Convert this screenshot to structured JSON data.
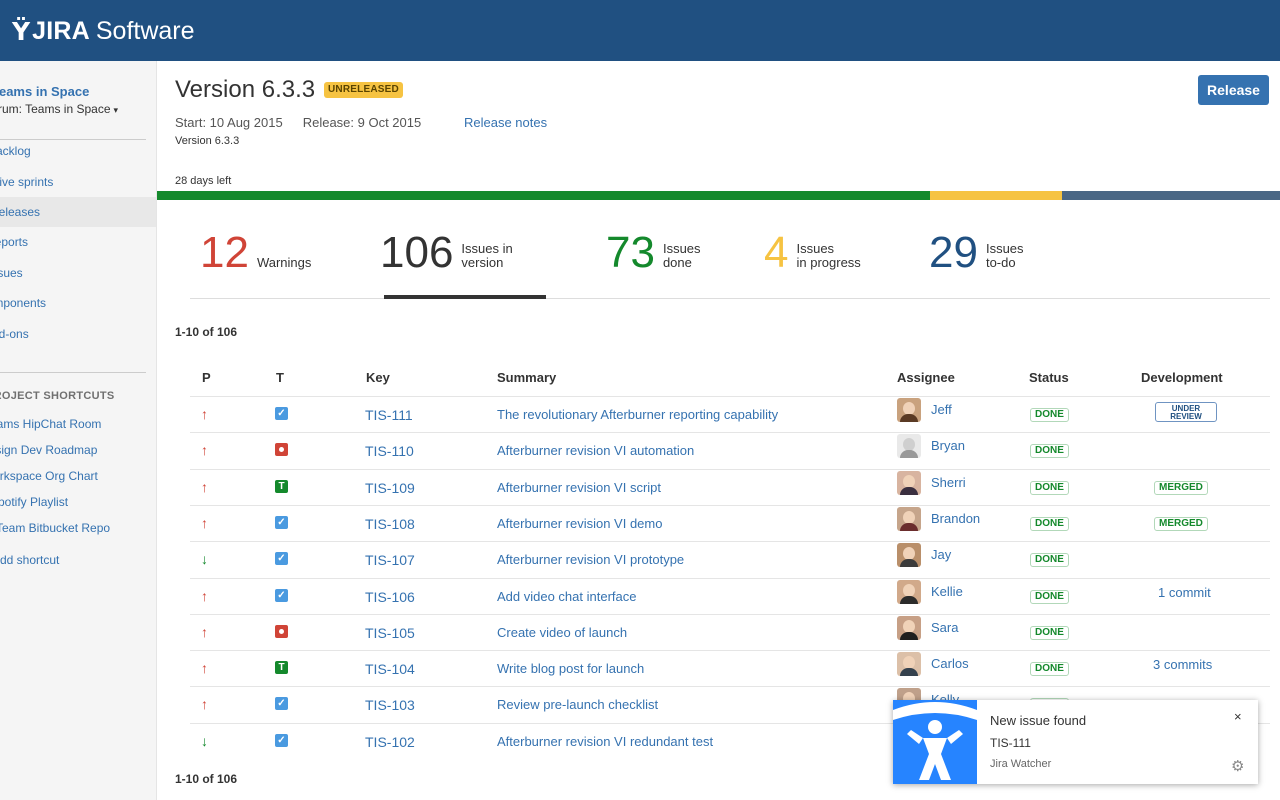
{
  "app": {
    "logo_mark": "Ÿ",
    "brand": "JIRA",
    "product": "Software"
  },
  "sidebar": {
    "project_name": "Teams in Space",
    "board_name": "Scrum: Teams in Space",
    "nav": [
      {
        "label": "Backlog",
        "active": false
      },
      {
        "label": "Active sprints",
        "active": false
      },
      {
        "label": "Releases",
        "active": true
      },
      {
        "label": "Reports",
        "active": false
      },
      {
        "label": "Issues",
        "active": false
      },
      {
        "label": "Components",
        "active": false
      },
      {
        "label": "Add-ons",
        "active": false
      }
    ],
    "shortcuts_heading": "PROJECT SHORTCUTS",
    "shortcuts": [
      "Teams HipChat Room",
      "Design Dev Roadmap",
      "Workspace Org Chart",
      "Spotify Playlist",
      "Team Bitbucket Repo",
      "Add shortcut"
    ]
  },
  "header": {
    "title": "Version 6.3.3",
    "lozenge": "UNRELEASED",
    "release_button": "Release",
    "start": "Start: 10 Aug 2015",
    "release": "Release: 9 Oct 2015",
    "release_notes": "Release notes",
    "description": "Version 6.3.3",
    "days_left": "28 days left"
  },
  "progress": {
    "done_fraction": 0.6887,
    "in_progress_fraction": 0.1174,
    "todo_fraction": 0.1939
  },
  "stats": [
    {
      "value": "12",
      "line1": "Warnings",
      "line2": "",
      "color": "#d04437"
    },
    {
      "value": "106",
      "line1": "Issues in",
      "line2": "version",
      "color": "#333333"
    },
    {
      "value": "73",
      "line1": "Issues",
      "line2": "done",
      "color": "#14892c"
    },
    {
      "value": "4",
      "line1": "Issues",
      "line2": "in progress",
      "color": "#f6c342"
    },
    {
      "value": "29",
      "line1": "Issues",
      "line2": "to-do",
      "color": "#205081"
    }
  ],
  "table": {
    "count": "1-10 of 106",
    "headers": {
      "p": "P",
      "t": "T",
      "key": "Key",
      "summary": "Summary",
      "assignee": "Assignee",
      "status": "Status",
      "development": "Development"
    },
    "rows": [
      {
        "priority": "↑",
        "priority_dir": "up",
        "type": "story",
        "key": "TIS-111",
        "summary": "The revolutionary Afterburner reporting capability",
        "assignee": "Jeff",
        "status": "DONE",
        "dev_kind": "review",
        "dev": "UNDER REVIEW"
      },
      {
        "priority": "↑",
        "priority_dir": "up",
        "type": "bug",
        "key": "TIS-110",
        "summary": "Afterburner revision VI automation",
        "assignee": "Bryan",
        "status": "DONE",
        "dev_kind": "",
        "dev": ""
      },
      {
        "priority": "↑",
        "priority_dir": "up",
        "type": "task",
        "key": "TIS-109",
        "summary": "Afterburner revision VI script",
        "assignee": "Sherri",
        "status": "DONE",
        "dev_kind": "merged",
        "dev": "MERGED"
      },
      {
        "priority": "↑",
        "priority_dir": "up",
        "type": "story",
        "key": "TIS-108",
        "summary": "Afterburner revision VI demo",
        "assignee": "Brandon",
        "status": "DONE",
        "dev_kind": "merged",
        "dev": "MERGED"
      },
      {
        "priority": "↓",
        "priority_dir": "down",
        "type": "story",
        "key": "TIS-107",
        "summary": "Afterburner revision VI prototype",
        "assignee": "Jay",
        "status": "DONE",
        "dev_kind": "",
        "dev": ""
      },
      {
        "priority": "↑",
        "priority_dir": "up",
        "type": "story",
        "key": "TIS-106",
        "summary": "Add video chat interface",
        "assignee": "Kellie",
        "status": "DONE",
        "dev_kind": "commit",
        "dev": "1 commit"
      },
      {
        "priority": "↑",
        "priority_dir": "up",
        "type": "bug",
        "key": "TIS-105",
        "summary": "Create video of launch",
        "assignee": "Sara",
        "status": "DONE",
        "dev_kind": "",
        "dev": ""
      },
      {
        "priority": "↑",
        "priority_dir": "up",
        "type": "task",
        "key": "TIS-104",
        "summary": "Write blog post for launch",
        "assignee": "Carlos",
        "status": "DONE",
        "dev_kind": "commit",
        "dev": "3 commits"
      },
      {
        "priority": "↑",
        "priority_dir": "up",
        "type": "story",
        "key": "TIS-103",
        "summary": "Review pre-launch checklist",
        "assignee": "Kelly",
        "status": "DONE",
        "dev_kind": "",
        "dev": ""
      },
      {
        "priority": "↓",
        "priority_dir": "down",
        "type": "story",
        "key": "TIS-102",
        "summary": "Afterburner revision VI redundant test",
        "assignee": "",
        "status": "",
        "dev_kind": "",
        "dev": ""
      }
    ]
  },
  "notification": {
    "title": "New issue found",
    "issue_key": "TIS-111",
    "source": "Jira Watcher",
    "close": "×",
    "gear_icon": "gear-icon",
    "logo_icon": "jira-logo-icon"
  },
  "colors": {
    "topbar": "#205081",
    "link": "#3572b0",
    "done": "#14892c",
    "in_progress": "#f6c342",
    "todo": "#4a6785",
    "warning": "#d04437"
  }
}
